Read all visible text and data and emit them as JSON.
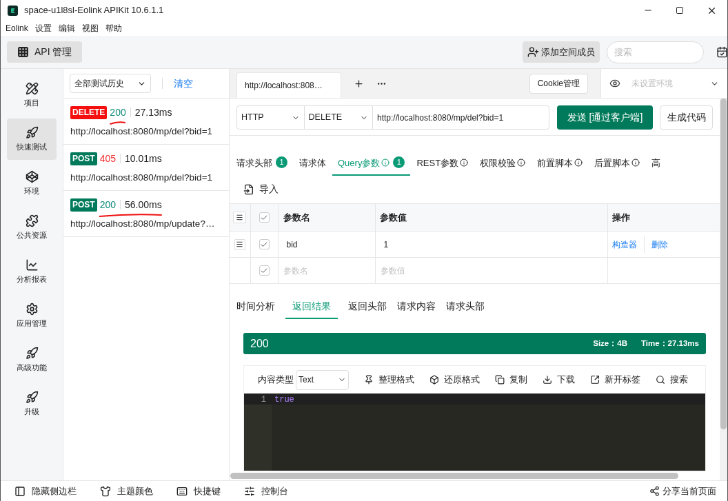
{
  "window": {
    "title": "space-u1l8sl-Eolink APIKit 10.6.1.1"
  },
  "menu": [
    "Eolink",
    "设置",
    "编辑",
    "视图",
    "帮助"
  ],
  "toolbar": {
    "module_button": "API 管理",
    "add_member_button": "添加空间成员",
    "search_placeholder": "搜索"
  },
  "sidebar": {
    "items": [
      {
        "label": "项目",
        "selected": false
      },
      {
        "label": "快速测试",
        "selected": true
      },
      {
        "label": "环境",
        "selected": false
      },
      {
        "label": "公共资源",
        "selected": false
      },
      {
        "label": "分析报表",
        "selected": false
      },
      {
        "label": "应用管理",
        "selected": false
      },
      {
        "label": "高级功能",
        "selected": false
      },
      {
        "label": "升级",
        "selected": false
      }
    ]
  },
  "history": {
    "filter": "全部测试历史",
    "clear_button": "清空",
    "items": [
      {
        "method": {
          "label": "DELETE",
          "color": "#f50f0f"
        },
        "status": {
          "text": "200",
          "color": "#0f8a7a"
        },
        "time": "27.13ms",
        "url": "http://localhost:8080/mp/del?bid=1",
        "status_underlined": true,
        "time_underlined": false
      },
      {
        "method": {
          "label": "POST",
          "color": "#007a5a"
        },
        "status": {
          "text": "405",
          "color": "#f53131"
        },
        "time": "10.01ms",
        "url": "http://localhost:8080/mp/del?bid=1",
        "status_underlined": false,
        "time_underlined": false
      },
      {
        "method": {
          "label": "POST",
          "color": "#007a5a"
        },
        "status": {
          "text": "200",
          "color": "#0f8a7a"
        },
        "time": "56.00ms",
        "url": "http://localhost:8080/mp/update?…",
        "status_underlined": true,
        "time_underlined": true
      }
    ]
  },
  "request": {
    "tab_label": "http://localhost:808…",
    "cookie_button": "Cookie管理",
    "environment_placeholder": "未设置环境",
    "protocol": "HTTP",
    "method": "DELETE",
    "url": "http://localhost:8080/mp/del?bid=1",
    "send_button": "发送 [通过客户端]",
    "codegen_button": "生成代码"
  },
  "request_tabs": [
    {
      "label": "请求头部",
      "info": false,
      "badge": "1",
      "selected": false
    },
    {
      "label": "请求体",
      "info": false,
      "selected": false
    },
    {
      "label": "Query参数",
      "info": true,
      "badge": "1",
      "selected": true
    },
    {
      "label": "REST参数",
      "info": true,
      "selected": false
    },
    {
      "label": "权限校验",
      "info": true,
      "selected": false
    },
    {
      "label": "前置脚本",
      "info": true,
      "selected": false
    },
    {
      "label": "后置脚本",
      "info": true,
      "selected": false
    },
    {
      "label": "高",
      "info": false,
      "selected": false
    }
  ],
  "import_button": "导入",
  "params_table": {
    "all_checked": true,
    "columns": [
      "参数名",
      "参数值",
      "操作"
    ],
    "rows": [
      {
        "kind": "filled",
        "checked": true,
        "name": "bid",
        "value": "1",
        "actions": [
          "构造器",
          "删除"
        ]
      },
      {
        "kind": "empty",
        "checked": true,
        "name_placeholder": "参数名",
        "value_placeholder": "参数值"
      }
    ]
  },
  "response_tabs": [
    {
      "label": "时间分析",
      "selected": false
    },
    {
      "label": "返回结果",
      "selected": true
    },
    {
      "label": "返回头部",
      "selected": false
    },
    {
      "label": "请求内容",
      "selected": false
    },
    {
      "label": "请求头部",
      "selected": false
    }
  ],
  "response": {
    "status": "200",
    "size": "Size：4B",
    "time": "Time：27.13ms"
  },
  "viewer": {
    "content_type_label": "内容类型",
    "content_type": "Text",
    "tools": [
      "整理格式",
      "还原格式",
      "复制",
      "下载",
      "新开标签",
      "搜索"
    ],
    "lines": [
      {
        "number": "1",
        "text": "true"
      }
    ]
  },
  "status_bar": {
    "items": [
      "隐藏侧边栏",
      "主题颜色",
      "快捷键",
      "控制台"
    ],
    "share": "分享当前页面"
  }
}
